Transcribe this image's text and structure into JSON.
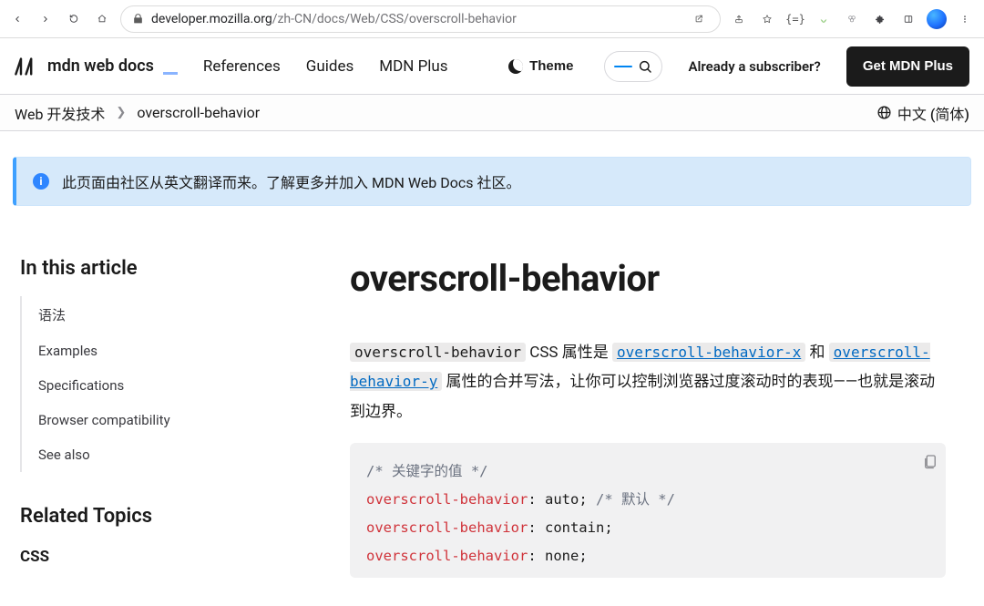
{
  "browser": {
    "host": "developer.mozilla.org",
    "path": "/zh-CN/docs/Web/CSS/overscroll-behavior"
  },
  "header": {
    "logo_text": "mdn web docs",
    "nav": {
      "references": "References",
      "guides": "Guides",
      "plus": "MDN Plus"
    },
    "theme_label": "Theme",
    "subscriber_text": "Already a subscriber?",
    "cta_label": "Get MDN Plus"
  },
  "breadcrumbs": {
    "root": "Web 开发技术",
    "current": "overscroll-behavior",
    "language": "中文 (简体)"
  },
  "banner": {
    "text_prefix": "此页面由社区从英文翻译而来。了解更多并加入 ",
    "link_text": "MDN Web Docs 社区",
    "text_suffix": "。"
  },
  "toc": {
    "heading": "In this article",
    "items": [
      "语法",
      "Examples",
      "Specifications",
      "Browser compatibility",
      "See also"
    ]
  },
  "related": {
    "heading": "Related Topics",
    "sub": "CSS"
  },
  "article": {
    "title": "overscroll-behavior",
    "intro": {
      "code": "overscroll-behavior",
      "t1": " CSS 属性是 ",
      "link1": "overscroll-behavior-x",
      "t2": " 和 ",
      "link2": "overscroll-behavior-y",
      "t3": " 属性的合并写法，让你可以控制浏览器过度滚动时的表现——也就是滚动到边界。"
    },
    "code_example": {
      "c1": "/* 关键字的值 */",
      "p": "overscroll-behavior",
      "v1": "auto",
      "c2": "/* 默认 */",
      "v2": "contain",
      "v3": "none"
    }
  }
}
